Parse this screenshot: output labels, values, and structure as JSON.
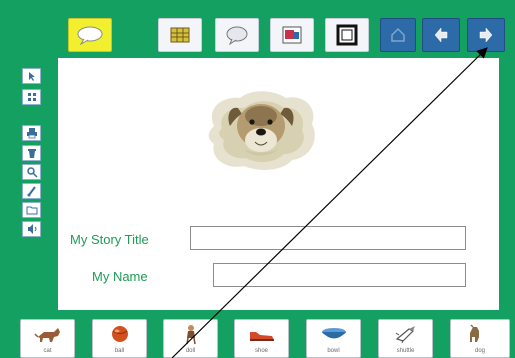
{
  "top_toolbar": {
    "buttons": [
      {
        "name": "speech-cloud-button",
        "icon": "speech-cloud-icon",
        "style": "yellow"
      },
      {
        "name": "flag-button",
        "icon": "flag-icon",
        "style": "light"
      },
      {
        "name": "speech-bubble-button",
        "icon": "speech-bubble-icon",
        "style": "light"
      },
      {
        "name": "picture-button",
        "icon": "picture-icon",
        "style": "light"
      },
      {
        "name": "frame-button",
        "icon": "frame-icon",
        "style": "light"
      },
      {
        "name": "home-button",
        "icon": "home-icon",
        "style": "blue"
      },
      {
        "name": "previous-page-button",
        "icon": "back-arrow-icon",
        "style": "blue"
      },
      {
        "name": "next-page-button",
        "icon": "forward-arrow-icon",
        "style": "blue"
      }
    ]
  },
  "left_toolbar": {
    "tools": [
      {
        "name": "pointer-tool",
        "icon": "arrow-icon"
      },
      {
        "name": "grid-tool",
        "icon": "grid-icon"
      },
      {
        "name": "print-tool",
        "icon": "printer-icon"
      },
      {
        "name": "trash-tool",
        "icon": "trash-icon"
      },
      {
        "name": "zoom-tool",
        "icon": "magnifier-icon"
      },
      {
        "name": "paint-tool",
        "icon": "brush-icon"
      },
      {
        "name": "save-tool",
        "icon": "folder-icon"
      },
      {
        "name": "sound-tool",
        "icon": "speaker-icon"
      }
    ]
  },
  "story": {
    "image": "dog-photo",
    "title_label": "My Story Title",
    "title_value": "",
    "name_label": "My Name",
    "name_value": ""
  },
  "picture_strip": {
    "items": [
      {
        "icon": "cat-icon",
        "label": "cat"
      },
      {
        "icon": "ball-icon",
        "label": "ball"
      },
      {
        "icon": "doll-icon",
        "label": "doll"
      },
      {
        "icon": "shoe-icon",
        "label": "shoe"
      },
      {
        "icon": "bowl-icon",
        "label": "bowl"
      },
      {
        "icon": "shuttle-icon",
        "label": "shuttle"
      },
      {
        "icon": "dog-icon",
        "label": "dog"
      }
    ]
  },
  "colors": {
    "background": "#14a060",
    "label_text": "#1e9c57",
    "highlight": "#f2f02e",
    "nav_blue": "#2c6aa8"
  }
}
